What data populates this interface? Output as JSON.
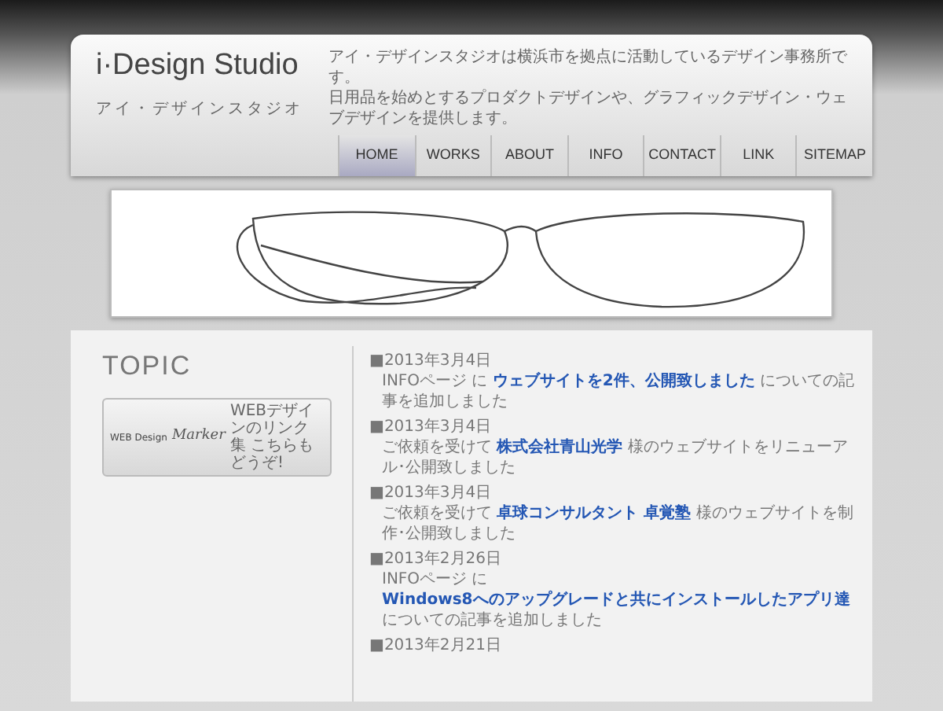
{
  "header": {
    "logo": "i·Design Studio",
    "logo_reading": "アイ・デザインスタジオ",
    "description": [
      "アイ・デザインスタジオは横浜市を拠点に活動しているデザイン事務所です。",
      "日用品を始めとするプロダクトデザインや、グラフィックデザイン・ウェブデザインを提供します。"
    ]
  },
  "nav": [
    {
      "label": "HOME",
      "selected": true
    },
    {
      "label": "WORKS",
      "selected": false
    },
    {
      "label": "ABOUT",
      "selected": false
    },
    {
      "label": "INFO",
      "selected": false
    },
    {
      "label": "CONTACT",
      "selected": false
    },
    {
      "label": "LINK",
      "selected": false
    },
    {
      "label": "SITEMAP",
      "selected": false
    }
  ],
  "topic": {
    "title": "TOPIC",
    "banner": {
      "brand": "WEB Design",
      "script": "Marker",
      "caption": "WEBデザインのリンク集 こちらもどうぞ!"
    }
  },
  "news": [
    {
      "date": "■2013年3月4日",
      "before": "INFOページ に ",
      "link": "ウェブサイトを2件、公開致しました",
      "after": " についての記事を追加しました"
    },
    {
      "date": "■2013年3月4日",
      "before": "ご依頼を受けて ",
      "link": "株式会社青山光学",
      "after": " 様のウェブサイトをリニューアル･公開致しました"
    },
    {
      "date": "■2013年3月4日",
      "before": "ご依頼を受けて ",
      "link": "卓球コンサルタント 卓覚塾",
      "after": " 様のウェブサイトを制作･公開致しました"
    },
    {
      "date": "■2013年2月26日",
      "before": "INFOページ に ",
      "link": "Windows8へのアップグレードと共にインストールしたアプリ達",
      "after": " についての記事を追加しました"
    },
    {
      "date": "■2013年2月21日"
    }
  ]
}
